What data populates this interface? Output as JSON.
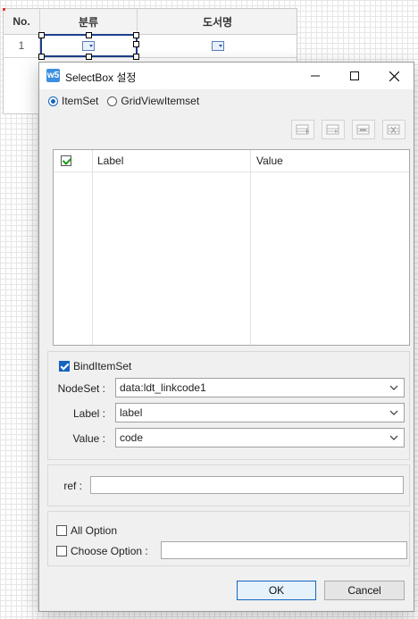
{
  "grid": {
    "columns": [
      "No.",
      "분류",
      "도서명"
    ],
    "row_number": "1"
  },
  "dialog": {
    "title": "SelectBox 설정",
    "app_icon_text": "w5",
    "radio_itemset": "ItemSet",
    "radio_gridview": "GridViewItemset",
    "table": {
      "col_label": "Label",
      "col_value": "Value"
    },
    "bind": {
      "checkbox_label": "BindItemSet",
      "nodeset_label": "NodeSet :",
      "nodeset_value": "data:ldt_linkcode1",
      "label_label": "Label :",
      "label_value": "label",
      "value_label": "Value :",
      "value_value": "code"
    },
    "ref_label": "ref :",
    "ref_value": "",
    "all_option": "All Option",
    "choose_option": "Choose Option :",
    "choose_option_value": "",
    "ok": "OK",
    "cancel": "Cancel"
  },
  "colors": {
    "accent": "#1565c0",
    "check_green": "#1a9b1a"
  }
}
